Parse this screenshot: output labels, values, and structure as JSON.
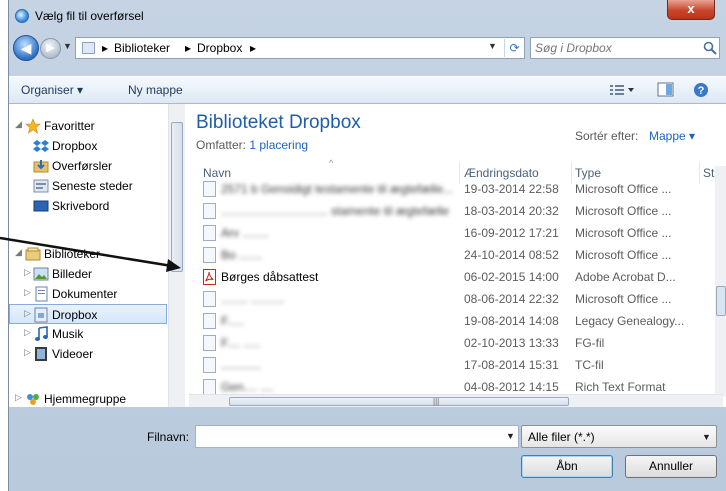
{
  "window": {
    "title": "Vælg fil til overførsel",
    "close_label": "x"
  },
  "address": {
    "segments": [
      "Biblioteker",
      "Dropbox"
    ],
    "separator": "▸",
    "search_placeholder": "Søg i Dropbox"
  },
  "toolbar": {
    "organize_label": "Organiser ▾",
    "new_folder_label": "Ny mappe"
  },
  "navpane": {
    "favorites_label": "Favoritter",
    "favorites": [
      "Dropbox",
      "Overførsler",
      "Seneste steder",
      "Skrivebord"
    ],
    "libraries_label": "Biblioteker",
    "libraries": [
      "Billeder",
      "Dokumenter",
      "Dropbox",
      "Musik",
      "Videoer"
    ],
    "homegroup_label": "Hjemmegruppe"
  },
  "library": {
    "title": "Biblioteket Dropbox",
    "includes_prefix": "Omfatter:",
    "includes_link": "1 placering",
    "sort_label": "Sortér efter:",
    "sort_value": "Mappe ▾"
  },
  "columns": {
    "name": "Navn",
    "date": "Ændringsdato",
    "type": "Type",
    "size": "St"
  },
  "files": [
    {
      "name": "2571 b Gensidigt testamente til ægtefælle...",
      "date": "19-03-2014 22:58",
      "type": "Microsoft Office ...",
      "blurred": true
    },
    {
      "name": "................................ stamente til ægtefælle",
      "date": "18-03-2014 20:32",
      "type": "Microsoft Office ...",
      "blurred": true
    },
    {
      "name": "Arv ........",
      "date": "16-09-2012 17:21",
      "type": "Microsoft Office ...",
      "blurred": true
    },
    {
      "name": "Bo .......",
      "date": "24-10-2014 08:52",
      "type": "Microsoft Office ...",
      "blurred": true
    },
    {
      "name": "Børges dåbsattest",
      "date": "06-02-2015 14:00",
      "type": "Adobe Acrobat D...",
      "blurred": false
    },
    {
      "name": "........ ..........",
      "date": "08-06-2014 22:32",
      "type": "Microsoft Office ...",
      "blurred": true
    },
    {
      "name": "F.....",
      "date": "19-08-2014 14:08",
      "type": "Legacy Genealogy...",
      "blurred": true
    },
    {
      "name": "F.... .....",
      "date": "02-10-2013 13:33",
      "type": "FG-fil",
      "blurred": true
    },
    {
      "name": "............",
      "date": "17-08-2014 15:31",
      "type": "TC-fil",
      "blurred": true
    },
    {
      "name": "Gen.... ....",
      "date": "04-08-2012 14:15",
      "type": "Rich Text Format",
      "blurred": true
    }
  ],
  "footer": {
    "filename_label": "Filnavn:",
    "filename_value": "",
    "filter_value": "Alle filer (*.*)",
    "open_label": "Åbn",
    "cancel_label": "Annuller"
  },
  "colors": {
    "accent": "#1e5fa8",
    "selection": "#d3e6fb",
    "pdf": "#c8281e"
  }
}
